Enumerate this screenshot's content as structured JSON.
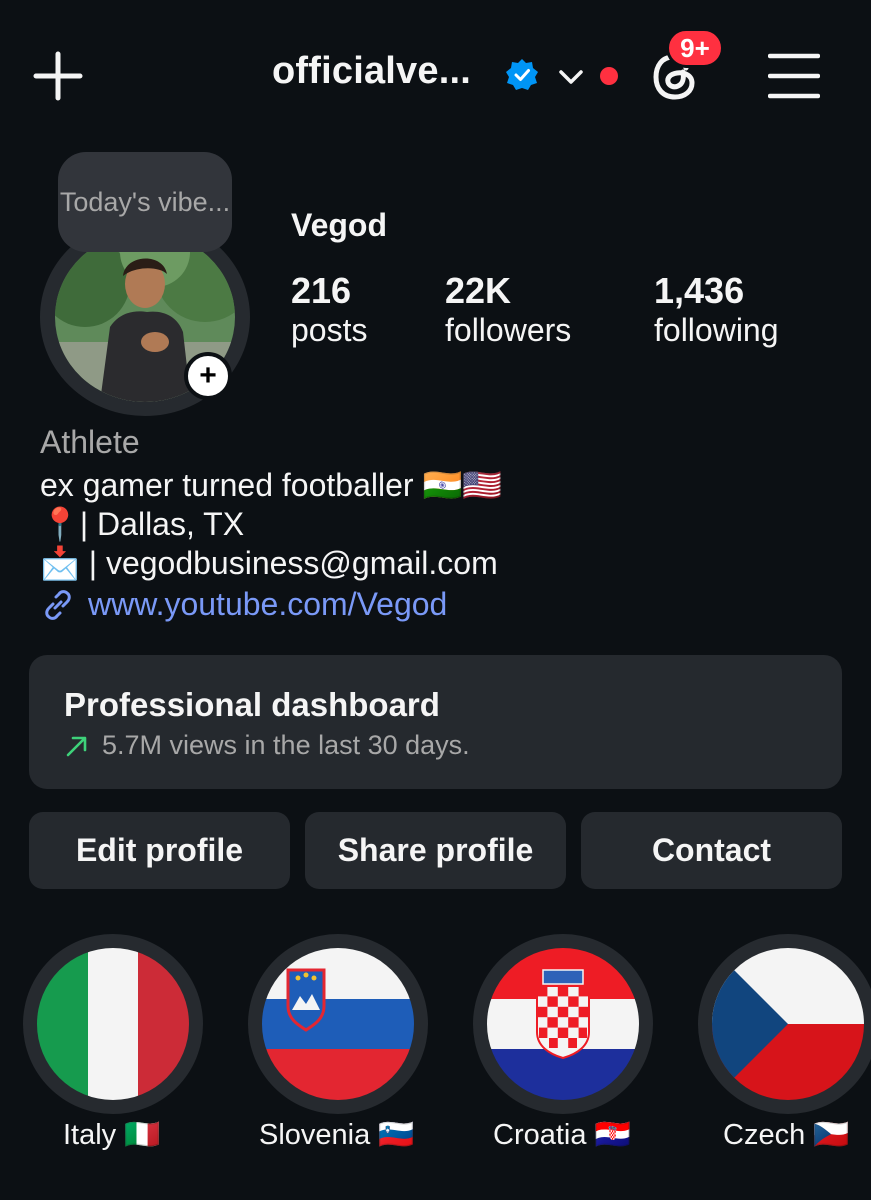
{
  "header": {
    "username": "officialve...",
    "notification_badge": "9+",
    "icons": [
      "plus-icon",
      "verified-badge-icon",
      "chevron-down-icon",
      "threads-icon",
      "hamburger-menu-icon"
    ]
  },
  "profile": {
    "note": "Today's vibe...",
    "display_name": "Vegod",
    "stats": [
      {
        "value": "216",
        "label": "posts"
      },
      {
        "value": "22K",
        "label": "followers"
      },
      {
        "value": "1,436",
        "label": "following"
      }
    ],
    "category": "Athlete",
    "bio": [
      "ex gamer turned footballer 🇮🇳🇺🇸",
      "📍| Dallas, TX",
      "📩 | vegodbusiness@gmail.com"
    ],
    "link": "www.youtube.com/Vegod"
  },
  "dashboard": {
    "title": "Professional dashboard",
    "subtitle": "5.7M views in the last 30 days."
  },
  "buttons": {
    "edit": "Edit profile",
    "share": "Share profile",
    "contact": "Contact"
  },
  "highlights": [
    {
      "label": "Italy 🇮🇹"
    },
    {
      "label": "Slovenia 🇸🇮"
    },
    {
      "label": "Croatia 🇭🇷"
    },
    {
      "label": "Czech 🇨🇿"
    }
  ],
  "colors": {
    "background": "#0c1014",
    "surface": "#25292e",
    "accent_link": "#7a99f7",
    "badge_red": "#ff3040",
    "verified_blue": "#0095f6",
    "trend_green": "#3ed17a"
  }
}
